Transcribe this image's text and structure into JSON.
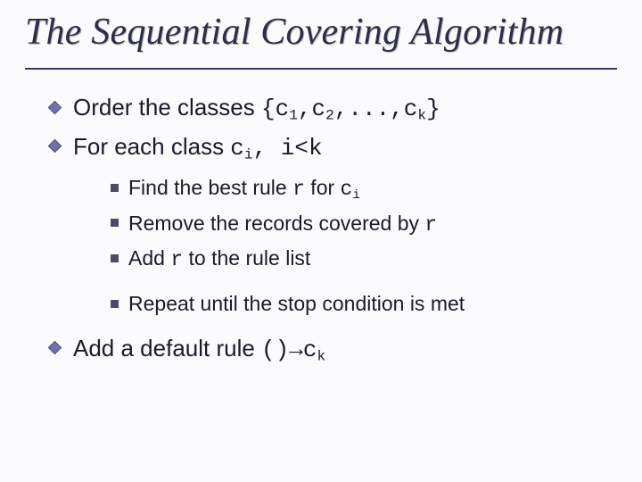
{
  "title": "The Sequential Covering Algorithm",
  "bullets": {
    "b1_pre": "Order the classes ",
    "b1_code_open": "{c",
    "b1_sub1": "1",
    "b1_code_mid1": ",c",
    "b1_sub2": "2",
    "b1_code_mid2": ",...,c",
    "b1_subk": "k",
    "b1_code_close": "}",
    "b2_pre": "For each class ",
    "b2_code_c": "c",
    "b2_sub_i": "i",
    "b2_code_comma": ", ",
    "b2_code_cond": "i<k",
    "s1_pre": "Find the best rule ",
    "s1_code_r": "r",
    "s1_mid": " for ",
    "s1_code_c": "c",
    "s1_sub_i": "i",
    "s2_pre": "Remove the records covered by ",
    "s2_code_r": "r",
    "s3_pre": "Add ",
    "s3_code_r": "r",
    "s3_post": " to the rule list",
    "s4": "Repeat until the stop condition is met",
    "b3_pre": "Add a default rule ",
    "b3_code_lp": "()",
    "b3_arrow": "→",
    "b3_code_c": "c",
    "b3_sub_k": "k"
  }
}
